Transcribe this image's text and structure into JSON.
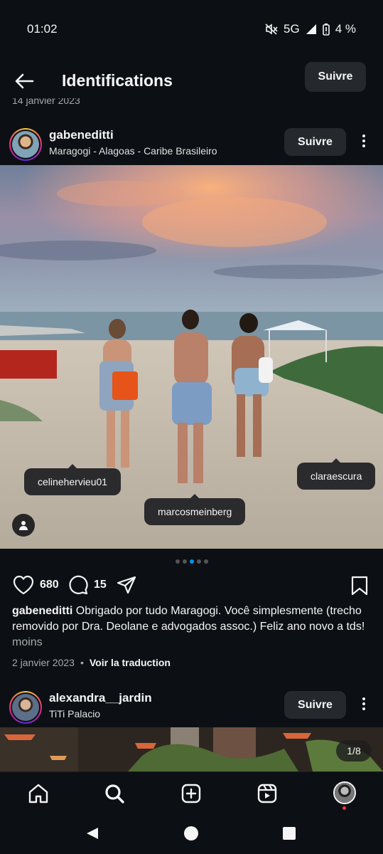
{
  "status": {
    "time": "01:02",
    "network": "5G",
    "battery": "4 %"
  },
  "header": {
    "title": "Identifications",
    "follow_label": "Suivre"
  },
  "previous_date": "14 janvier 2023",
  "post1": {
    "username": "gabeneditti",
    "location": "Maragogi - Alagoas - Caribe Brasileiro",
    "follow_label": "Suivre",
    "tags": [
      "celinehervieu01",
      "marcosmeinberg",
      "claraescura"
    ],
    "likes": "680",
    "comments": "15",
    "caption_user": "gabeneditti",
    "caption_text": "Obrigado por tudo Maragogi. Você simplesmente (trecho removido por Dra. Deolane e advogados assoc.) Feliz ano novo a tds!",
    "caption_more": "moins",
    "date": "2 janvier 2023",
    "translate": "Voir la traduction",
    "carousel": {
      "total": 5,
      "active": 3
    }
  },
  "post2": {
    "username": "alexandra__jardin",
    "location": "TiTi Palacio",
    "follow_label": "Suivre",
    "counter": "1/8"
  },
  "nav": {
    "items": [
      "home-icon",
      "search-icon",
      "create-icon",
      "reels-icon",
      "profile-avatar"
    ]
  },
  "colors": {
    "background": "#0c1014",
    "button": "#25292e",
    "accent": "#0095f6"
  }
}
